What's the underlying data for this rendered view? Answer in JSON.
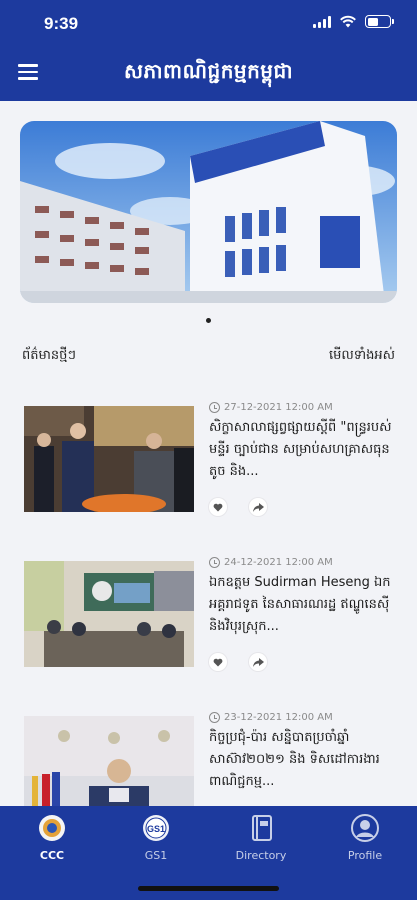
{
  "status_bar": {
    "time": "9:39"
  },
  "header": {
    "title": "សភាពាណិជ្ជកម្មកម្ពុជា",
    "menu_icon": "hamburger-icon"
  },
  "carousel": {
    "slide_count": 1,
    "active_index": 0
  },
  "news_section": {
    "heading": "ព័ត៌មានថ្មីៗ",
    "see_all_label": "មើលទាំងអស់"
  },
  "news": [
    {
      "date": "27-12-2021 12:00 AM",
      "title": "សិក្ខាសាលាផ្សព្វផ្សាយស្តីពី \"ពន្ធ្ររបស់មន្ទីរ ច្បាប់ជាន សម្រាប់សហគ្រាសធុនតូច និង..."
    },
    {
      "date": "24-12-2021 12:00 AM",
      "title": "ឯកឧត្តម Sudirman Heseng ឯកអគ្គរាជទូត នៃសាធារណរដ្ឋ ឥណ្ឌូនេស៊ីនិងវិបុរស្រុក..."
    },
    {
      "date": "23-12-2021 12:00 AM",
      "title": "កិច្ចប្រជុំ-ប៉ារ សន្និបាតប្រចាំឆ្នាំ សាស៊ាវ២០២១ និង ទិសដៅការងារពាណិជ្ជកម្ម..."
    }
  ],
  "tabbar": {
    "tabs": [
      {
        "label": "CCC",
        "active": true
      },
      {
        "label": "GS1",
        "active": false
      },
      {
        "label": "Directory",
        "active": false
      },
      {
        "label": "Profile",
        "active": false
      }
    ]
  },
  "colors": {
    "brand_blue": "#1d3a9e",
    "background": "#f2f3f7"
  }
}
